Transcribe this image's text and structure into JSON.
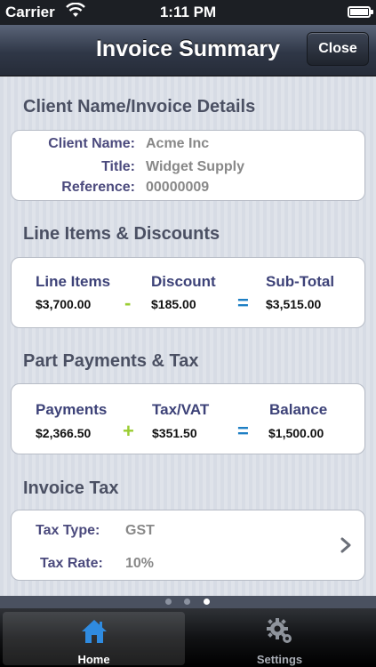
{
  "status_bar": {
    "carrier": "Carrier",
    "time": "1:11 PM"
  },
  "nav": {
    "title": "Invoice Summary",
    "close_label": "Close"
  },
  "client_section": {
    "title": "Client Name/Invoice Details",
    "client_name_label": "Client Name:",
    "client_name_value": "Acme Inc",
    "title_label": "Title:",
    "title_value": "Widget Supply",
    "reference_label": "Reference:",
    "reference_value": "00000009"
  },
  "line_items_section": {
    "title": "Line Items & Discounts",
    "line_items_label": "Line Items",
    "line_items_value": "$3,700.00",
    "minus": "-",
    "discount_label": "Discount",
    "discount_value": "$185.00",
    "equals": "=",
    "subtotal_label": "Sub-Total",
    "subtotal_value": "$3,515.00"
  },
  "payments_section": {
    "title": "Part Payments & Tax",
    "payments_label": "Payments",
    "payments_value": "$2,366.50",
    "plus": "+",
    "tax_label": "Tax/VAT",
    "tax_value": "$351.50",
    "equals": "=",
    "balance_label": "Balance",
    "balance_value": "$1,500.00"
  },
  "tax_section": {
    "title": "Invoice Tax",
    "tax_type_label": "Tax Type:",
    "tax_type_value": "GST",
    "tax_rate_label": "Tax Rate:",
    "tax_rate_value": "10%"
  },
  "page_indicator": {
    "count": 3,
    "active_index": 2
  },
  "tab_bar": {
    "tabs": [
      {
        "label": "Home",
        "icon": "home-icon",
        "selected": true
      },
      {
        "label": "Settings",
        "icon": "gear-icon",
        "selected": false
      }
    ]
  },
  "colors": {
    "plus_minus": "#9acd32",
    "equals": "#1e7fc4",
    "label_text": "#4b4a7d",
    "home_icon": "#2f8be0"
  }
}
